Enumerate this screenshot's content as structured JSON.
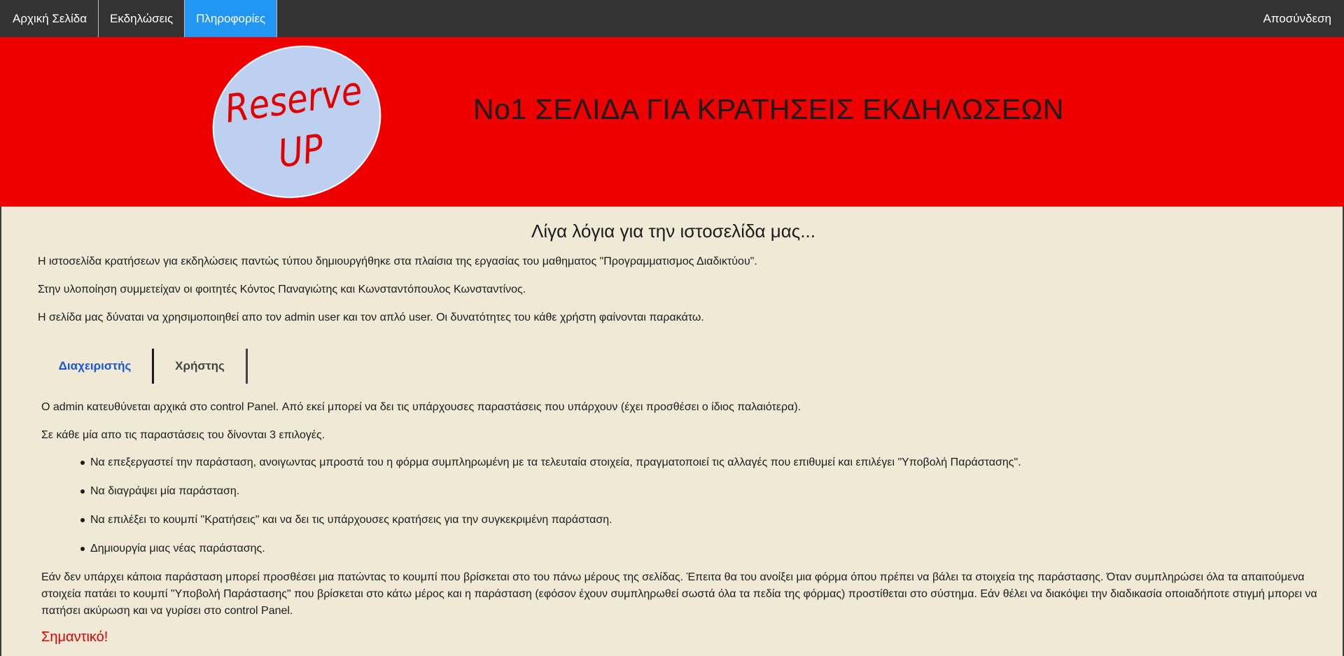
{
  "nav": {
    "home": "Αρχική Σελίδα",
    "events": "Εκδηλώσεις",
    "info": "Πληροφορίες",
    "logout": "Αποσύνδεση"
  },
  "banner": {
    "logo_line1": "Reserve",
    "logo_line2": "UP",
    "title": "No1 ΣΕΛΙΔΑ ΓΙΑ ΚΡΑΤΗΣΕΙΣ ΕΚΔΗΛΩΣΕΩΝ"
  },
  "about": {
    "title": "Λίγα λόγια για την ιστοσελίδα μας...",
    "p1": "Η ιστοσελίδα κρατήσεων για εκδηλώσεις παντώς τύπου δημιουργήθηκε στα πλαίσια της εργασίας του μαθηματος \"Προγραμματισμος Διαδικτύου\".",
    "p2": "Στην υλοποίηση συμμετείχαν οι φοιτητές Κόντος Παναγιώτης και Κωνσταντόπουλος Κωνσταντίνος.",
    "p3": "Η σελίδα μας δύναται να χρησιμοποιηθεί απο τον admin user και τον απλό user. Οι δυνατότητες του κάθε χρήστη φαίνονται παρακάτω."
  },
  "tabs": {
    "admin": "Διαχειριστής",
    "user": "Χρήστης"
  },
  "admin_section": {
    "intro": "O admin κατευθύνεται αρχικά στο control Panel. Από εκεί μπορεί να δει τις υπάρχουσες παραστάσεις που υπάρχουν (έχει προσθέσει ο ίδιος παλαιότερα).",
    "options_intro": "Σε κάθε μία απο τις παραστάσεις του δίνονται 3 επιλογές.",
    "bullets": [
      "Να επεξεργαστεί την παράσταση, ανοιγωντας μπροστά του η φόρμα συμπληρωμένη με τα τελευταία στοιχεία, πραγματοποιεί τις αλλαγές που επιθυμεί και επιλέγει \"Υποβολή Παράστασης\".",
      "Να διαγράψει μία παράσταση.",
      "Να επιλέξει το κουμπί \"Κρατήσεις\" και να δει τις υπάρχουσες κρατήσεις για την συγκεκριμένη παράσταση.",
      "Δημιουργία μιας νέας παράστασης."
    ],
    "add_paragraph": "Εάν δεν υπάρχει κάποια παράσταση μπορεί προσθέσει μια πατώντας το κουμπί που βρίσκεται στο του πάνω μέρους της σελίδας. Έπειτα θα του ανοίξει μια φόρμα όπου πρέπει να βάλει τα στοιχεία της παράστασης. Όταν συμπληρώσει όλα τα απαιτούμενα στοιχεία πατάει το κουμπί \"Υποβολή Παράστασης\" που βρίσκεται στο κάτω μέρος και η παράσταση (εφόσον έχουν συμπληρωθεί σωστά όλα τα πεδία της φόρμας) προστίθεται στο σύστημα. Εάν θέλει να διακόψει την διαδικασία οποιαδήποτε στιγμή μπορει να πατήσει ακύρωση και να γυρίσει στο control Panel.",
    "important": "Σημαντικό!"
  },
  "colors": {
    "nav_bg": "#333333",
    "nav_active": "#2196f3",
    "banner_bg": "#ee0000",
    "page_bg": "#efe9d6",
    "logo_fill": "#bdd0f0",
    "logo_text": "#e00000",
    "tab_active": "#1a56d6",
    "important": "#e00000"
  }
}
